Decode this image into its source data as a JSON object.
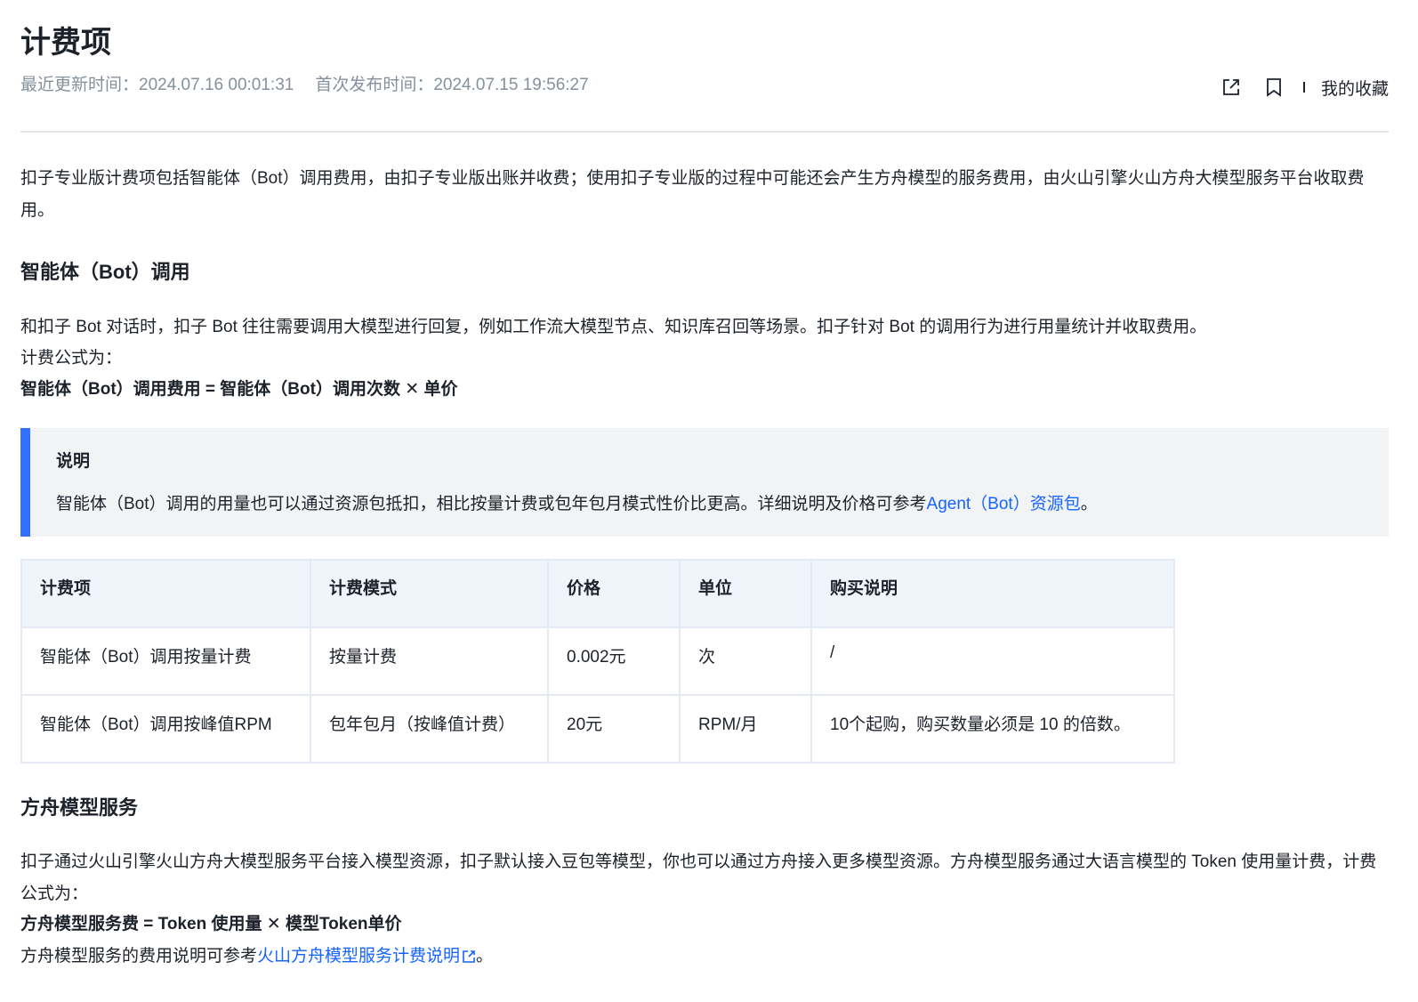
{
  "header": {
    "title": "计费项",
    "updated": "最近更新时间：2024.07.16 00:01:31",
    "published": "首次发布时间：2024.07.15 19:56:27",
    "favorites_label": "我的收藏"
  },
  "intro": "扣子专业版计费项包括智能体（Bot）调用费用，由扣子专业版出账并收费；使用扣子专业版的过程中可能还会产生方舟模型的服务费用，由火山引擎火山方舟大模型服务平台收取费用。",
  "bot_section": {
    "heading": "智能体（Bot）调用",
    "description": "和扣子 Bot 对话时，扣子 Bot 往往需要调用大模型进行回复，例如工作流大模型节点、知识库召回等场景。扣子针对 Bot 的调用行为进行用量统计并收取费用。",
    "formula_label": "计费公式为：",
    "formula": "智能体（Bot）调用费用 = 智能体（Bot）调用次数 ✕ 单价",
    "note": {
      "title": "说明",
      "text": "智能体（Bot）调用的用量也可以通过资源包抵扣，相比按量计费或包年包月模式性价比更高。详细说明及价格可参考",
      "link": "Agent（Bot）资源包",
      "suffix": "。"
    },
    "table": {
      "headers": [
        "计费项",
        "计费模式",
        "价格",
        "单位",
        "购买说明"
      ],
      "rows": [
        [
          "智能体（Bot）调用按量计费",
          "按量计费",
          "0.002元",
          "次",
          "/"
        ],
        [
          "智能体（Bot）调用按峰值RPM",
          "包年包月（按峰值计费）",
          "20元",
          "RPM/月",
          "10个起购，购买数量必须是 10 的倍数。"
        ]
      ]
    }
  },
  "ark_section": {
    "heading": "方舟模型服务",
    "description": "扣子通过火山引擎火山方舟大模型服务平台接入模型资源，扣子默认接入豆包等模型，你也可以通过方舟接入更多模型资源。方舟模型服务通过大语言模型的 Token 使用量计费，计费公式为：",
    "formula": "方舟模型服务费 = Token 使用量 ✕ 模型Token单价",
    "ref_text": "方舟模型服务的费用说明可参考",
    "ref_link": "火山方舟模型服务计费说明",
    "ref_suffix": "。"
  },
  "icons": {
    "share": "external-share-icon",
    "bookmark": "bookmark-icon",
    "external_link": "external-link-icon"
  },
  "colors": {
    "link": "#1664ff",
    "note_bar": "#3370ff",
    "meta_text": "#86909c"
  }
}
